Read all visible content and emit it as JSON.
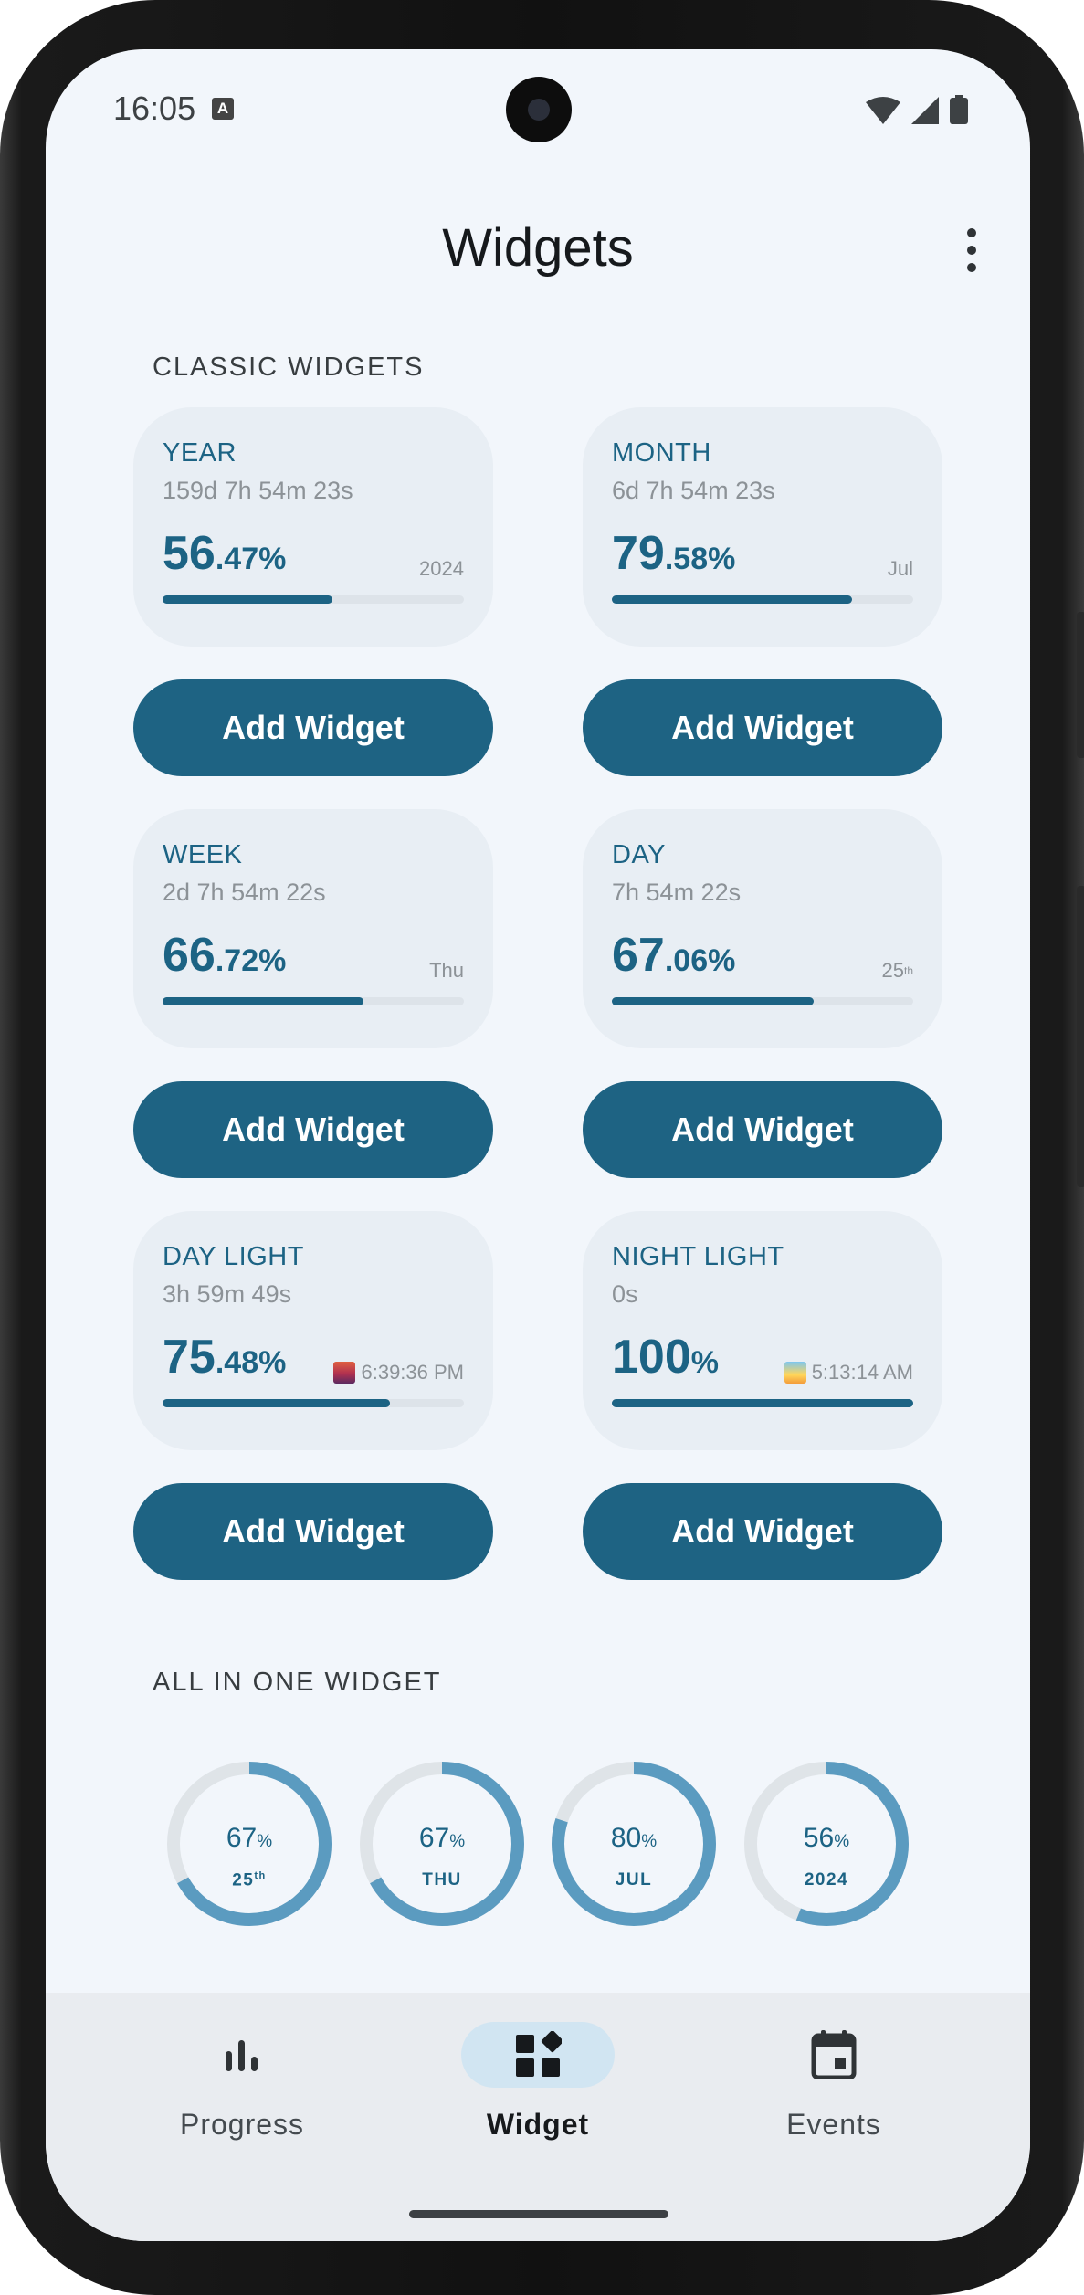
{
  "status_bar": {
    "time": "16:05",
    "indicator": "A"
  },
  "app_bar": {
    "title": "Widgets"
  },
  "classic_section": {
    "title": "CLASSIC WIDGETS"
  },
  "widgets": [
    {
      "label": "YEAR",
      "remaining": "159d 7h 54m 23s",
      "int": "56",
      "frac": ".47%",
      "progress": 0.5647,
      "suffix": "2024"
    },
    {
      "label": "MONTH",
      "remaining": "6d 7h 54m 23s",
      "int": "79",
      "frac": ".58%",
      "progress": 0.7958,
      "suffix": "Jul"
    },
    {
      "label": "WEEK",
      "remaining": "2d 7h 54m 22s",
      "int": "66",
      "frac": ".72%",
      "progress": 0.6672,
      "suffix": "Thu"
    },
    {
      "label": "DAY",
      "remaining": "7h 54m 22s",
      "int": "67",
      "frac": ".06%",
      "progress": 0.6706,
      "suffix": "25",
      "suffix_sup": "th"
    },
    {
      "label": "DAY LIGHT",
      "remaining": "3h 59m 49s",
      "int": "75",
      "frac": ".48%",
      "progress": 0.7548,
      "suffix": "6:39:36 PM",
      "suffix_icon": "sunset-icon"
    },
    {
      "label": "NIGHT LIGHT",
      "remaining": "0s",
      "int": "100",
      "frac": "%",
      "progress": 1.0,
      "suffix": "5:13:14 AM",
      "suffix_icon": "sunrise-icon"
    }
  ],
  "add_widget_label": "Add Widget",
  "all_in_one_section": {
    "title": "ALL IN ONE WIDGET"
  },
  "rings": [
    {
      "pct": "67",
      "unit": "%",
      "sub": "25",
      "sub_sup": "th",
      "progress": 0.67
    },
    {
      "pct": "67",
      "unit": "%",
      "sub": "THU",
      "progress": 0.67
    },
    {
      "pct": "80",
      "unit": "%",
      "sub": "JUL",
      "progress": 0.8
    },
    {
      "pct": "56",
      "unit": "%",
      "sub": "2024",
      "progress": 0.56
    }
  ],
  "colors": {
    "accent": "#1e6383",
    "ring": "#5b9bc0",
    "ring_track": "#dfe4e8",
    "card": "#e8eef4",
    "background": "#f2f6fb"
  },
  "nav": [
    {
      "label": "Progress",
      "icon": "bar-chart-icon",
      "active": false
    },
    {
      "label": "Widget",
      "icon": "widgets-icon",
      "active": true
    },
    {
      "label": "Events",
      "icon": "calendar-icon",
      "active": false
    }
  ]
}
